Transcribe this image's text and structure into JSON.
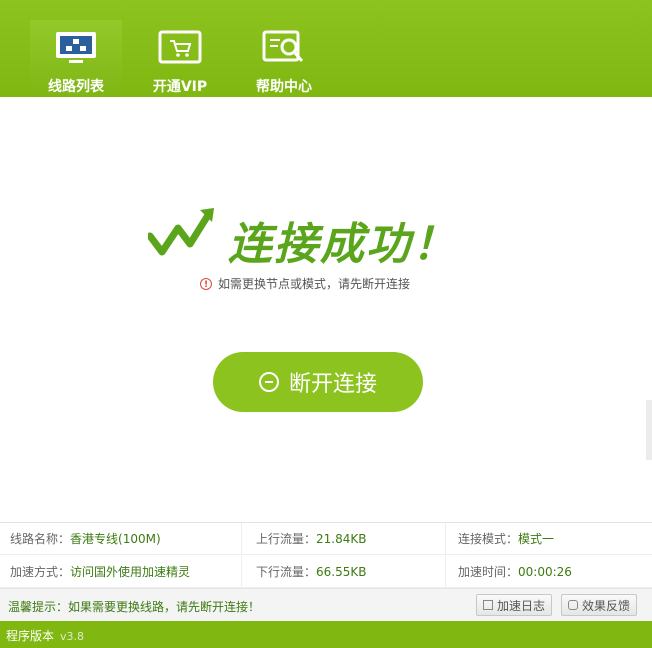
{
  "tabs": [
    {
      "label": "线路列表",
      "icon": "route-list-icon",
      "active": true
    },
    {
      "label": "开通VIP",
      "icon": "cart-icon",
      "active": false
    },
    {
      "label": "帮助中心",
      "icon": "help-search-icon",
      "active": false
    }
  ],
  "status": {
    "headline": "连接成功！",
    "notice": "如需更换节点或模式，请先断开连接",
    "disconnect_label": "断开连接"
  },
  "info": {
    "line_name_label": "线路名称：",
    "line_name_value": "香港专线(100M)",
    "upload_label": "上行流量：",
    "upload_value": "21.84KB",
    "mode_label": "连接模式：",
    "mode_value": "模式一",
    "method_label": "加速方式：",
    "method_value": "访问国外使用加速精灵",
    "download_label": "下行流量：",
    "download_value": "66.55KB",
    "time_label": "加速时间：",
    "time_value": "00:00:26"
  },
  "tip": {
    "text": "温馨提示：如果需要更换线路，请先断开连接！",
    "log_button": "加速日志",
    "feedback_button": "效果反馈"
  },
  "footer": {
    "label": "程序版本",
    "version": "v3.8"
  },
  "colors": {
    "brand": "#80b711",
    "accent": "#8cc31f",
    "text_green": "#3d7a12"
  }
}
